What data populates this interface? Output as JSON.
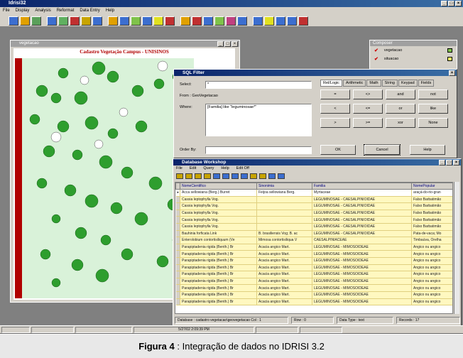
{
  "app": {
    "title": "Idrisi32",
    "menu": [
      "File",
      "Display",
      "Analysis",
      "Reformat",
      "Data Entry",
      "Help"
    ]
  },
  "map_window": {
    "title": "vegetacao",
    "map_title": "Cadastro Vegetação Campus - UNISINOS"
  },
  "composer": {
    "title": "Composer",
    "layers": [
      {
        "name": "vegetacao",
        "color": "#7fc24a"
      },
      {
        "name": "situacao",
        "color": "#ffff66"
      }
    ]
  },
  "sql_filter": {
    "title": "SQL Filter",
    "select_label": "Select:",
    "select_value": "*",
    "from_label": "From : GeoVegetacao",
    "where_label": "Where:",
    "where_value": "[Familia] like \"leguminosae*\"",
    "order_label": "Order By:",
    "order_value": "",
    "tabs": [
      "Rel/Logic",
      "Arithmetic",
      "Math",
      "String",
      "Keypad",
      "Fields"
    ],
    "operators": [
      "=",
      "<>",
      "and",
      "not",
      "<",
      "<=",
      "or",
      "like",
      ">",
      ">=",
      "xor",
      "None"
    ],
    "ok_label": "OK",
    "cancel_label": "Cancel",
    "help_label": "Help"
  },
  "db_workshop": {
    "title": "Database Workshop",
    "menu": [
      "File",
      "Edit",
      "Query",
      "Help",
      "Edit Off"
    ],
    "columns": [
      "NomeCientifico",
      "Sinonimia",
      "Familia",
      "NomePopular"
    ],
    "rows": [
      [
        "Acca sellowiana (Berg.) Burret",
        "Feijoa sellowiana Berg.",
        "Myrtaceae",
        "araçá-do-rio-gran"
      ],
      [
        "Cassia leptophylla Vog.",
        "",
        "LEGUMINOSAE - CAESALPINIOIDAE",
        "Falso Barbatimão"
      ],
      [
        "Cassia leptophylla Vog.",
        "",
        "LEGUMINOSAE - CAESALPINIOIDAE",
        "Falso Barbatimão"
      ],
      [
        "Cassia leptophylla Vog.",
        "",
        "LEGUMINOSAE - CAESALPINIOIDAE",
        "Falso Barbatimão"
      ],
      [
        "Cassia leptophylla Vog.",
        "",
        "LEGUMINOSAE - CAESALPINIOIDAE",
        "Falso Barbatimão"
      ],
      [
        "Cassia leptophylla Vog.",
        "",
        "LEGUMINOSAE - CAESALPINIOIDAE",
        "Falso Barbatimão"
      ],
      [
        "Bauhinia forficata Link",
        "B. brasiliensis Vog; B. ac",
        "LEGUMINOSAE - CAESALPINIOIDAE",
        "Pata-de-vaca; Mo"
      ],
      [
        "Enterolobium contortisiliquum (Ve",
        "Mimosa contortisiliqua V",
        "CAESALPINIACEAE",
        "Timbaúva, Orelha"
      ],
      [
        "Parapiptadenia rigida (Benth.) Br",
        "Acacia angico Mart.",
        "LEGUMINOSAE - MIMOSOIDEAE",
        "Angico ou angico"
      ],
      [
        "Parapiptadenia rigida (Benth.) Br",
        "Acacia angico Mart.",
        "LEGUMINOSAE - MIMOSOIDEAE",
        "Angico ou angico"
      ],
      [
        "Parapiptadenia rigida (Benth.) Br",
        "Acacia angico Mart.",
        "LEGUMINOSAE - MIMOSOIDEAE",
        "Angico ou angico"
      ],
      [
        "Parapiptadenia rigida (Benth.) Br",
        "Acacia angico Mart.",
        "LEGUMINOSAE - MIMOSOIDEAE",
        "Angico ou angico"
      ],
      [
        "Parapiptadenia rigida (Benth.) Br",
        "Acacia angico Mart.",
        "LEGUMINOSAE - MIMOSOIDEAE",
        "Angico ou angico"
      ],
      [
        "Parapiptadenia rigida (Benth.) Br",
        "Acacia angico Mart.",
        "LEGUMINOSAE - MIMOSOIDEAE",
        "Angico ou angico"
      ],
      [
        "Parapiptadenia rigida (Benth.) Br",
        "Acacia angico Mart.",
        "LEGUMINOSAE - MIMOSOIDEAE",
        "Angico ou angico"
      ],
      [
        "Parapiptadenia rigida (Benth.) Br",
        "Acacia angico Mart.",
        "LEGUMINOSAE - MIMOSOIDEAE",
        "Angico ou angico"
      ],
      [
        "Parapiptadenia rigida (Benth.) Br",
        "Acacia angico Mart.",
        "LEGUMINOSAE - MIMOSOIDEAE",
        "Angico ou angico"
      ]
    ],
    "status": {
      "database": "Database : cadastro vegetacao\\geovegetacao  Col : 1",
      "row": "Row : 0",
      "datatype": "Data Type : text",
      "records": "Records : 17"
    }
  },
  "taskbar": {
    "clock": "5/27/02 2:09:39 PM"
  },
  "caption": {
    "label": "Figura 4",
    "text": ": Integração de dados no IDRISI 3.2"
  },
  "colors": {
    "tree": "#2e9e2e",
    "map_bg": "#d9f2d9",
    "title_red": "#b00000",
    "row_yellow": "#fff8c0"
  }
}
